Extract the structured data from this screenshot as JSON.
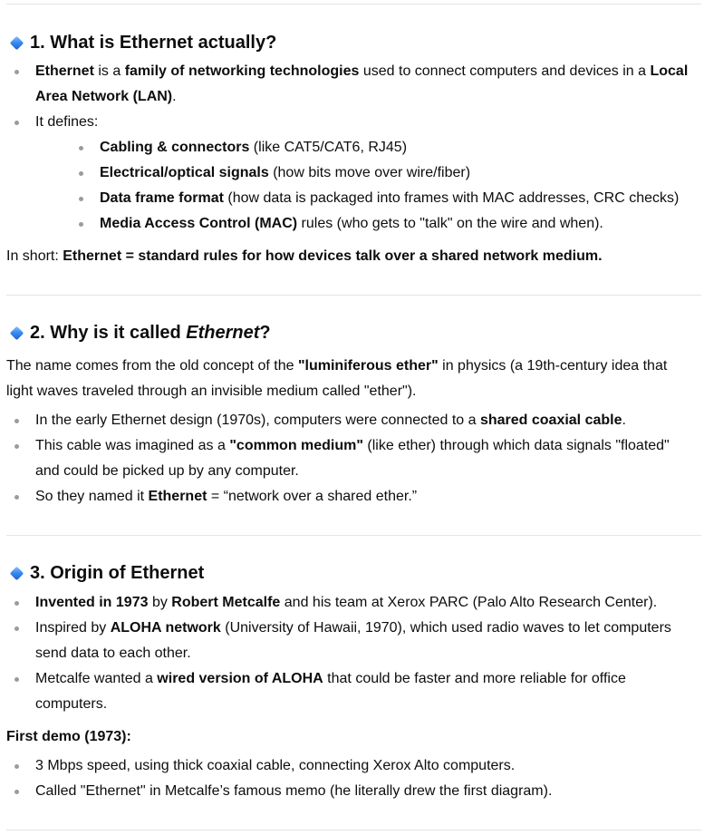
{
  "section1": {
    "icon": "blue-diamond-icon",
    "heading": "1. What is Ethernet actually?",
    "b1": {
      "t1": "Ethernet",
      "t2": " is a ",
      "t3": "family of networking technologies",
      "t4": " used to connect computers and devices in a ",
      "t5": "Local Area Network (LAN)",
      "t6": "."
    },
    "b2": "It defines:",
    "sub": [
      {
        "bold": "Cabling & connectors",
        "rest": " (like CAT5/CAT6, RJ45)"
      },
      {
        "bold": "Electrical/optical signals",
        "rest": " (how bits move over wire/fiber)"
      },
      {
        "bold": "Data frame format",
        "rest": " (how data is packaged into frames with MAC addresses, CRC checks)"
      },
      {
        "bold": "Media Access Control (MAC)",
        "rest": " rules (who gets to \"talk\" on the wire and when)."
      }
    ],
    "summary_lead": "In short: ",
    "summary_bold": "Ethernet = standard rules for how devices talk over a shared network medium."
  },
  "section2": {
    "icon": "blue-diamond-icon",
    "heading_lead": "2. Why is it called ",
    "heading_em": "Ethernet",
    "heading_tail": "?",
    "p1": "The name comes from the old concept of the ",
    "p2": "\"luminiferous ether\"",
    "p3": " in physics (a 19th-century idea that light waves traveled through an invisible medium called \"ether\").",
    "b1": {
      "t1": "In the early Ethernet design (1970s), computers were connected to a ",
      "t2": "shared coaxial cable",
      "t3": "."
    },
    "b2": {
      "t1": "This cable was imagined as a ",
      "t2": "\"common medium\"",
      "t3": " (like ether) through which data signals \"floated\" and could be picked up by any computer."
    },
    "b3": {
      "t1": "So they named it ",
      "t2": "Ethernet",
      "t3": " = “network over a shared ether.”"
    }
  },
  "section3": {
    "icon": "blue-diamond-icon",
    "heading": "3. Origin of Ethernet",
    "b1": {
      "t1": "Invented in 1973",
      "t2": " by ",
      "t3": "Robert Metcalfe",
      "t4": " and his team at Xerox PARC (Palo Alto Research Center)."
    },
    "b2": {
      "t1": "Inspired by ",
      "t2": "ALOHA network",
      "t3": " (University of Hawaii, 1970), which used radio waves to let computers send data to each other."
    },
    "b3": {
      "t1": "Metcalfe wanted a ",
      "t2": "wired version of ALOHA",
      "t3": " that could be faster and more reliable for office computers."
    },
    "demo_label": "First demo (1973):",
    "demo": [
      "3 Mbps speed, using thick coaxial cable, connecting Xerox Alto computers.",
      "Called \"Ethernet\" in Metcalfe’s famous memo (he literally drew the first diagram)."
    ]
  }
}
